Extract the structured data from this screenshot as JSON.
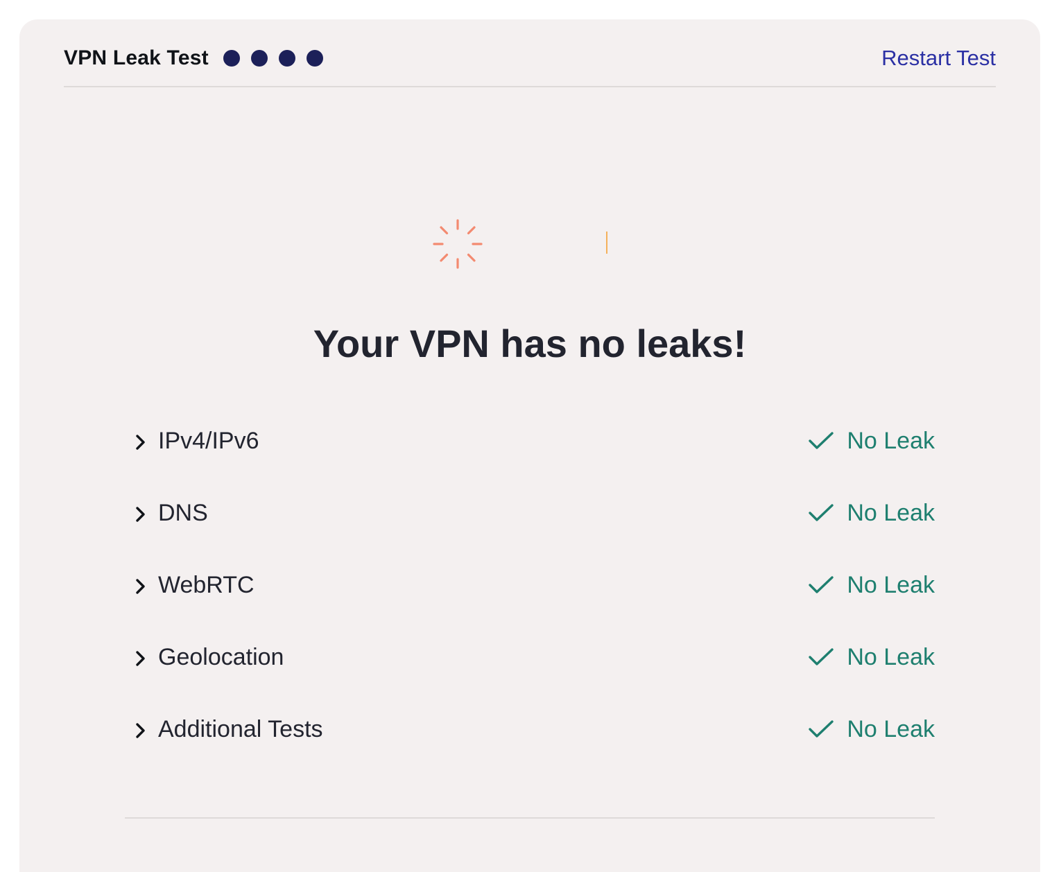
{
  "header": {
    "title": "VPN Leak Test",
    "progress_dots": 4,
    "restart_label": "Restart Test"
  },
  "status_graphic": {
    "icon": "loading-spinner-icon",
    "color": "#f38a70"
  },
  "headline": "Your VPN has no leaks!",
  "results": [
    {
      "label": "IPv4/IPv6",
      "status": "No Leak"
    },
    {
      "label": "DNS",
      "status": "No Leak"
    },
    {
      "label": "WebRTC",
      "status": "No Leak"
    },
    {
      "label": "Geolocation",
      "status": "No Leak"
    },
    {
      "label": "Additional Tests",
      "status": "No Leak"
    }
  ],
  "colors": {
    "card_background": "#f4f0f0",
    "accent_link": "#2b30a4",
    "dot": "#1c2059",
    "success": "#1e7f6f",
    "text": "#22242f"
  }
}
